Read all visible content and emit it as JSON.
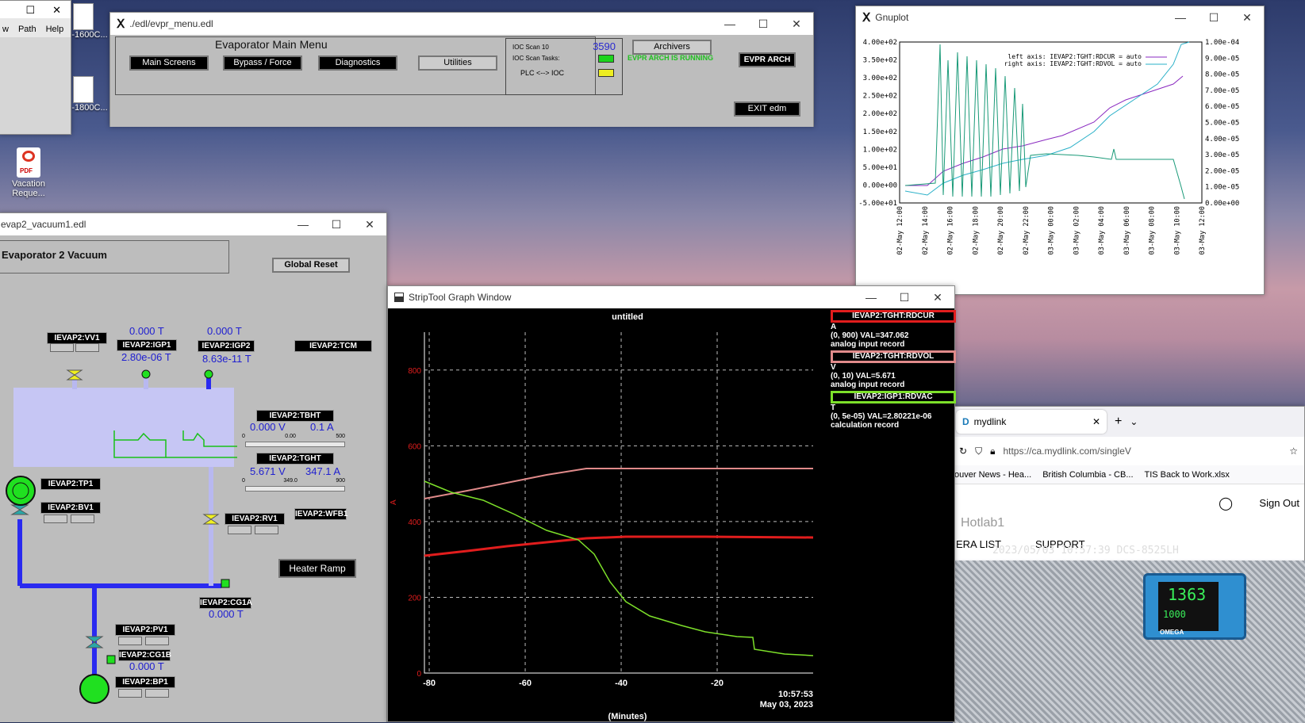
{
  "desktop": {
    "file1": "-1600C...",
    "file2": "-1800C...",
    "pdf_label": "Vacation Reque...",
    "pdf_badge": "PDF"
  },
  "leftwin": {
    "menu": [
      "w",
      "Path",
      "Help"
    ]
  },
  "evpr": {
    "title": "./edl/evpr_menu.edl",
    "heading": "Evaporator Main Menu",
    "buttons": [
      "Main Screens",
      "Bypass / Force",
      "Diagnostics",
      "Utilities"
    ],
    "ioc_scan": "IOC Scan 10",
    "ioc_scan_val": "3590",
    "ioc_tasks": "IOC Scan Tasks:",
    "plc": "PLC <--> IOC",
    "archivers": "Archivers",
    "arch_status": "EVPR ARCH IS RUNNING",
    "evpr_arch": "EVPR ARCH",
    "exit": "EXIT edm"
  },
  "gnuplot": {
    "title": "Gnuplot",
    "legend": [
      "left axis: IEVAP2:TGHT:RDCUR  = auto",
      "right axis: IEVAP2:TGHT:RDVOL  = auto"
    ],
    "y_left": [
      "4.00e+02",
      "3.50e+02",
      "3.00e+02",
      "2.50e+02",
      "2.00e+02",
      "1.50e+02",
      "1.00e+02",
      "5.00e+01",
      "0.00e+00",
      "-5.00e+01"
    ],
    "y_right": [
      "1.00e-04",
      "9.00e-05",
      "8.00e-05",
      "7.00e-05",
      "6.00e-05",
      "5.00e-05",
      "4.00e-05",
      "3.00e-05",
      "2.00e-05",
      "1.00e-05",
      "0.00e+00"
    ],
    "x": [
      "02-May 12:00",
      "02-May 14:00",
      "02-May 16:00",
      "02-May 18:00",
      "02-May 20:00",
      "02-May 22:00",
      "03-May 00:00",
      "03-May 02:00",
      "03-May 04:00",
      "03-May 06:00",
      "03-May 08:00",
      "03-May 10:00",
      "03-May 12:00"
    ]
  },
  "vac": {
    "title": "evap2_vacuum1.edl",
    "heading": "Evaporator 2 Vacuum",
    "reset": "Global Reset",
    "heater": "Heater Ramp",
    "pv": {
      "vv1": "IEVAP2:VV1",
      "igp1": "IEVAP2:IGP1",
      "igp2": "IEVAP2:IGP2",
      "tcm": "IEVAP2:TCM",
      "tbht": "IEVAP2:TBHT",
      "tght": "IEVAP2:TGHT",
      "tp1": "IEVAP2:TP1",
      "bv1": "IEVAP2:BV1",
      "rv1": "IEVAP2:RV1",
      "wfb1": "IEVAP2:WFB1",
      "cg1a": "IEVAP2:CG1A",
      "pv1": "IEVAP2:PV1",
      "cg1b": "IEVAP2:CG1B",
      "bp1": "IEVAP2:BP1"
    },
    "vals": {
      "vv1_t": "0.000 T",
      "igp1": "2.80e-06 T",
      "igp2_t": "0.000 T",
      "igp2": "8.63e-11 T",
      "tbht_v": "0.000 V",
      "tbht_a": "0.1 A",
      "tght_v": "5.671 V",
      "tght_a": "347.1 A",
      "cg1a": "0.000 T",
      "cg1b": "0.000 T",
      "scale1": [
        "0",
        "0.00",
        "500"
      ],
      "scale2": [
        "0",
        "349.0",
        "900"
      ]
    }
  },
  "strip": {
    "title": "StripTool Graph Window",
    "plot_title": "untitled",
    "y_ticks": [
      "800",
      "600",
      "400",
      "200",
      "0"
    ],
    "x_ticks": [
      "-80",
      "-60",
      "-40",
      "-20"
    ],
    "time": "10:57:53",
    "date": "May 03, 2023",
    "xlabel": "(Minutes)",
    "ylabel": "A",
    "legend": [
      {
        "name": "IEVAP2:TGHT:RDCUR",
        "unit": "A",
        "range": "(0, 900) VAL=347.062",
        "rec": "analog input record",
        "color": "#e11d1d"
      },
      {
        "name": "IEVAP2:TGHT:RDVOL",
        "unit": "V",
        "range": "(0, 10) VAL=5.671",
        "rec": "analog input record",
        "color": "#e08a8a"
      },
      {
        "name": "IEVAP2:IGP1:RDVAC",
        "unit": "T",
        "range": "(0, 5e-05) VAL=2.80221e-06",
        "rec": "calculation record",
        "color": "#7de02a"
      }
    ]
  },
  "browser": {
    "tab": "mydlink",
    "url": "https://ca.mydlink.com/singleV",
    "bookmarks": [
      "ouver News - Hea...",
      "British Columbia - CB...",
      "TIS Back to Work.xlsx"
    ],
    "site_title": "Hotlab1",
    "nav": [
      "ERA LIST",
      "SUPPORT"
    ],
    "signout": "Sign Out",
    "overlay": "2023/05/03 10:57:39 DCS-8525LH",
    "display": "1363",
    "display2": "1000",
    "brand": "OMEGA"
  }
}
